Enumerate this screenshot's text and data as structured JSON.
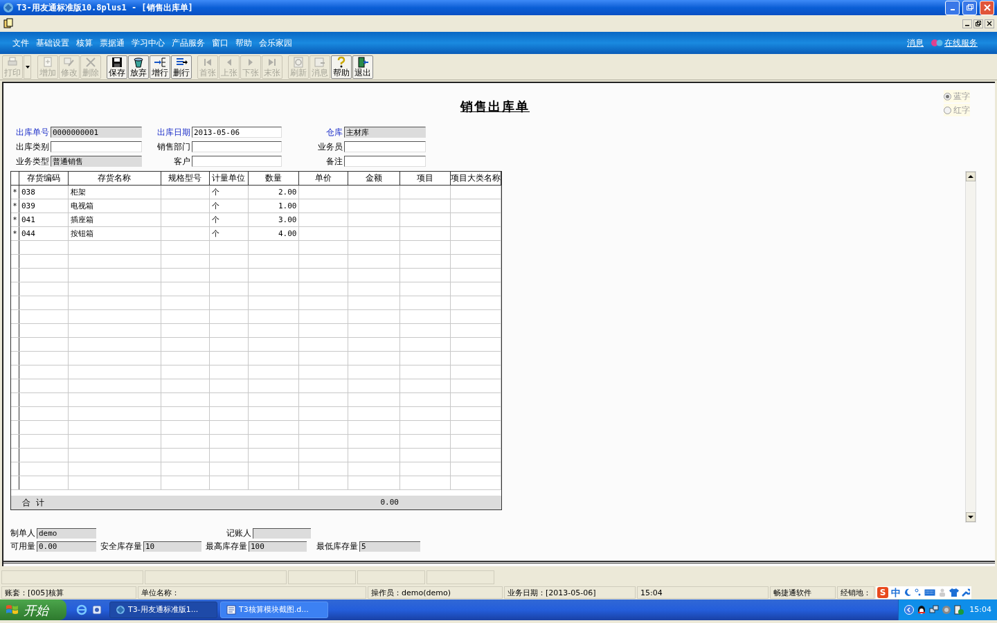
{
  "window": {
    "title": "T3-用友通标准版10.8plus1 - [销售出库单]"
  },
  "menu": [
    "文件",
    "基础设置",
    "核算",
    "票据通",
    "学习中心",
    "产品服务",
    "窗口",
    "帮助",
    "会乐家园"
  ],
  "menu_links": [
    "消息",
    "在线服务"
  ],
  "toolbar": [
    {
      "label": "打印",
      "enabled": false
    },
    {
      "label": "增加",
      "enabled": false
    },
    {
      "label": "修改",
      "enabled": false
    },
    {
      "label": "删除",
      "enabled": false
    },
    {
      "label": "保存",
      "enabled": true
    },
    {
      "label": "放弃",
      "enabled": true
    },
    {
      "label": "增行",
      "enabled": true
    },
    {
      "label": "删行",
      "enabled": true
    },
    {
      "label": "首张",
      "enabled": false
    },
    {
      "label": "上张",
      "enabled": false
    },
    {
      "label": "下张",
      "enabled": false
    },
    {
      "label": "末张",
      "enabled": false
    },
    {
      "label": "刷新",
      "enabled": false
    },
    {
      "label": "消息",
      "enabled": false
    },
    {
      "label": "帮助",
      "enabled": true
    },
    {
      "label": "退出",
      "enabled": true
    }
  ],
  "form": {
    "title": "销售出库单",
    "color_options": [
      {
        "label": "蓝字",
        "selected": true
      },
      {
        "label": "红字",
        "selected": false
      }
    ],
    "header_fields": [
      {
        "label": "出库单号",
        "value": "0000000001",
        "required": true,
        "readonly": true
      },
      {
        "label": "出库日期",
        "value": "2013-05-06",
        "required": true,
        "readonly": false
      },
      {
        "label": "仓库",
        "value": "主材库",
        "required": true,
        "readonly": true
      },
      {
        "label": "出库类别",
        "required": false,
        "readonly": false
      },
      {
        "label": "销售部门",
        "required": false,
        "readonly": false
      },
      {
        "label": "业务员",
        "required": false,
        "readonly": false
      },
      {
        "label": "业务类型",
        "value": "普通销售",
        "required": false,
        "readonly": true
      },
      {
        "label": "客户",
        "required": false,
        "readonly": false
      },
      {
        "label": "备注",
        "required": false,
        "readonly": false
      }
    ],
    "table": {
      "columns": [
        "存货编码",
        "存货名称",
        "规格型号",
        "计量单位",
        "数量",
        "单价",
        "金额",
        "项目",
        "项目大类名称"
      ],
      "rows": [
        {
          "marker": "*",
          "cells": [
            "038",
            "柜架",
            "",
            "个",
            "2.00",
            "",
            "",
            "",
            ""
          ]
        },
        {
          "marker": "*",
          "cells": [
            "039",
            "电视箱",
            "",
            "个",
            "1.00",
            "",
            "",
            "",
            ""
          ]
        },
        {
          "marker": "*",
          "cells": [
            "041",
            "插座箱",
            "",
            "个",
            "3.00",
            "",
            "",
            "",
            ""
          ]
        },
        {
          "marker": "*",
          "cells": [
            "044",
            "按钮箱",
            "",
            "个",
            "4.00",
            "",
            "",
            "",
            ""
          ]
        }
      ],
      "total": {
        "label": "合  计",
        "amount": "0.00"
      }
    },
    "footer_fields": [
      {
        "label": "制单人",
        "value": "demo"
      },
      {
        "label": "记账人"
      },
      {
        "label": "可用量",
        "value": "0.00"
      },
      {
        "label": "安全库存量",
        "value": "10"
      },
      {
        "label": "最高库存量",
        "value": "100"
      },
      {
        "label": "最低库存量",
        "value": "5"
      }
    ]
  },
  "status_bar": [
    "账套：[005]核算",
    "单位名称：",
    "操作员：demo(demo)",
    "业务日期：[2013-05-06]",
    "15:04",
    "畅捷通软件",
    "经销地："
  ],
  "ime": {
    "logo": "S",
    "mode": "中"
  },
  "taskbar": {
    "start": "开始",
    "tasks": [
      {
        "label": "T3-用友通标准版1...",
        "selected": true
      },
      {
        "label": "T3核算模块截图.d...",
        "selected": false
      }
    ],
    "clock": "15:04"
  }
}
